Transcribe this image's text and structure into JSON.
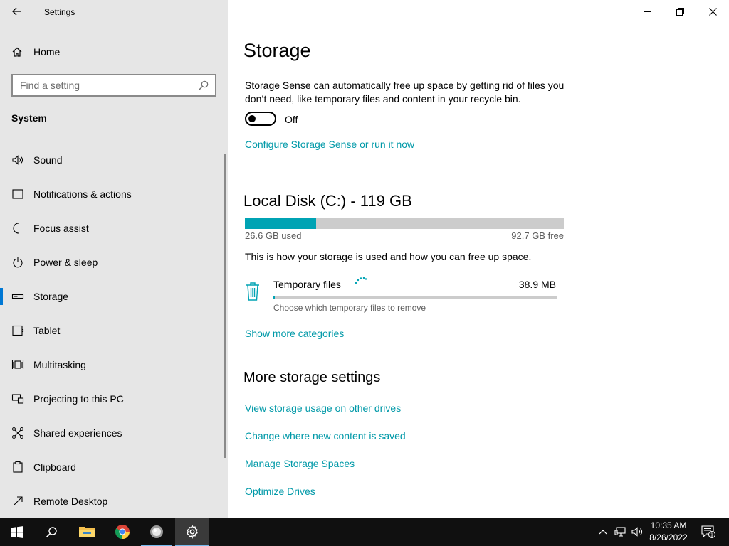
{
  "window": {
    "app_title": "Settings",
    "controls": {
      "minimize": "minimize",
      "restore": "restore",
      "close": "close"
    }
  },
  "sidebar": {
    "home_label": "Home",
    "search": {
      "placeholder": "Find a setting"
    },
    "section_label": "System",
    "items": [
      {
        "label": "Sound",
        "icon": "speaker-icon"
      },
      {
        "label": "Notifications & actions",
        "icon": "notification-icon"
      },
      {
        "label": "Focus assist",
        "icon": "moon-icon"
      },
      {
        "label": "Power & sleep",
        "icon": "power-icon"
      },
      {
        "label": "Storage",
        "icon": "storage-icon",
        "active": true
      },
      {
        "label": "Tablet",
        "icon": "tablet-icon"
      },
      {
        "label": "Multitasking",
        "icon": "multitasking-icon"
      },
      {
        "label": "Projecting to this PC",
        "icon": "projecting-icon"
      },
      {
        "label": "Shared experiences",
        "icon": "shared-icon"
      },
      {
        "label": "Clipboard",
        "icon": "clipboard-icon"
      },
      {
        "label": "Remote Desktop",
        "icon": "remote-desktop-icon"
      }
    ]
  },
  "main": {
    "title": "Storage",
    "storage_sense_desc": "Storage Sense can automatically free up space by getting rid of files you don’t need, like temporary files and content in your recycle bin.",
    "toggle": {
      "state_label": "Off",
      "on": false
    },
    "configure_link": "Configure Storage Sense or run it now",
    "disk": {
      "title": "Local Disk (C:) - 119 GB",
      "used_label": "26.6 GB used",
      "free_label": "92.7 GB free",
      "used_fraction": 0.224
    },
    "usage_desc": "This is how your storage is used and how you can free up space.",
    "categories": [
      {
        "name": "Temporary files",
        "size": "38.9 MB",
        "subtitle": "Choose which temporary files to remove",
        "fraction": 0.005
      }
    ],
    "show_more_link": "Show more categories",
    "more_section_title": "More storage settings",
    "more_links": [
      "View storage usage on other drives",
      "Change where new content is saved",
      "Manage Storage Spaces",
      "Optimize Drives"
    ]
  },
  "taskbar": {
    "apps": [
      "start",
      "search",
      "file-explorer",
      "chrome",
      "app",
      "settings"
    ],
    "clock": {
      "time": "10:35 AM",
      "date": "8/26/2022"
    },
    "notification_count": "1"
  },
  "colors": {
    "accent": "#0099a8",
    "bar_fill": "#00a3b4",
    "sidebar_bg": "#e6e6e6",
    "taskbar_bg": "#101010"
  }
}
